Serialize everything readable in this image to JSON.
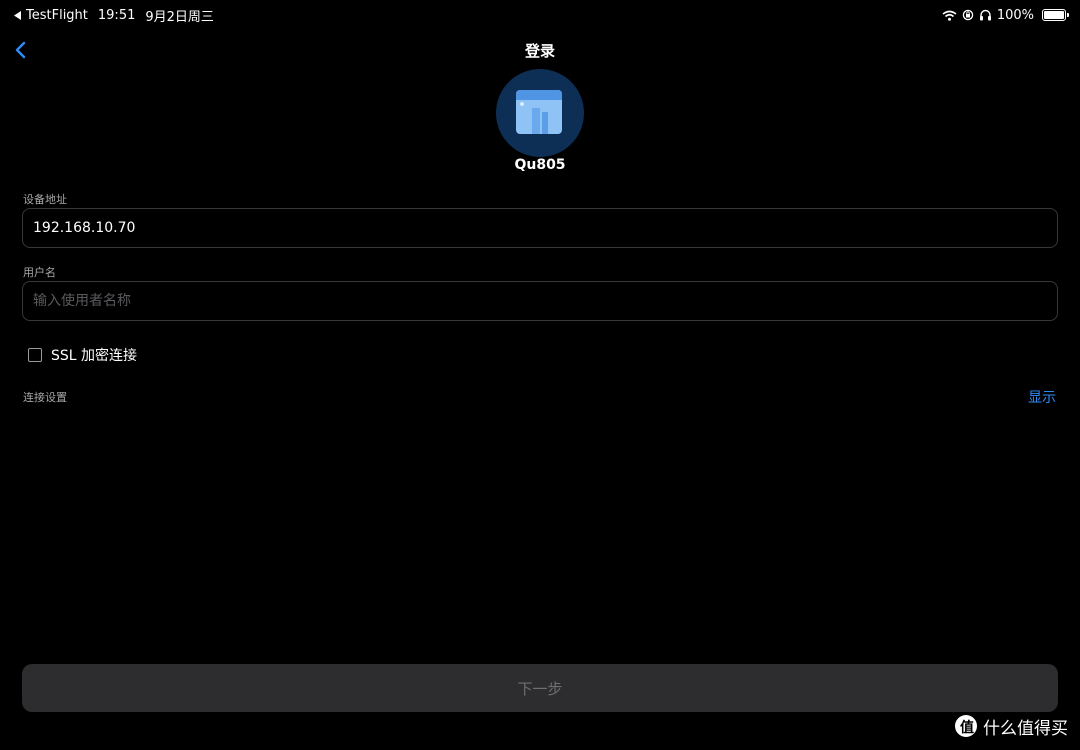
{
  "status_bar": {
    "back_app": "TestFlight",
    "time": "19:51",
    "date": "9月2日周三",
    "battery": "100%",
    "battery_level": 1.0
  },
  "nav": {
    "title": "登录",
    "back_icon": "chevron-left-icon"
  },
  "device": {
    "name": "Qu805",
    "icon": "nas-device-icon",
    "avatar_color": "#0e2f55"
  },
  "form": {
    "address_label": "设备地址",
    "address_value": "192.168.10.70",
    "username_label": "用户名",
    "username_placeholder": "输入使用者名称",
    "username_value": "",
    "ssl_label": "SSL 加密连接",
    "ssl_checked": false,
    "connection_settings_label": "连接设置",
    "connection_settings_action": "显示",
    "accent_color": "#2e8bf6"
  },
  "next_button": {
    "label": "下一步"
  },
  "watermark": {
    "text": "什么值得买",
    "logo_glyph": "值"
  }
}
